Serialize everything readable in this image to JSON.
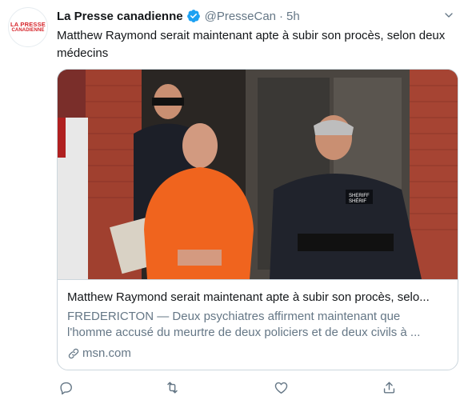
{
  "tweet": {
    "author": {
      "name": "La Presse canadienne",
      "handle": "@PresseCan",
      "separator": "·",
      "time": "5h",
      "avatar_line1": "LA PRESSE",
      "avatar_line2": "CANADIENNE",
      "verified_icon": "verified-badge-icon"
    },
    "text": "Matthew Raymond serait maintenant apte à subir son procès, selon deux médecins",
    "card": {
      "title": "Matthew Raymond serait maintenant apte à subir son procès, selo...",
      "description_line1": "FREDERICTON — Deux psychiatres affirment maintenant que",
      "description_line2": "l'homme accusé du meurtre de deux policiers et de deux civils à ...",
      "domain": "msn.com",
      "badge_text": "SHERIFF\nSHÉRIF"
    },
    "actions": [
      "reply-icon",
      "retweet-icon",
      "like-icon",
      "share-icon"
    ]
  },
  "colors": {
    "text_primary": "#14171a",
    "text_secondary": "#657786",
    "accent": "#1da1f2",
    "border": "#ccd6dd",
    "brand_red": "#d6242a"
  }
}
